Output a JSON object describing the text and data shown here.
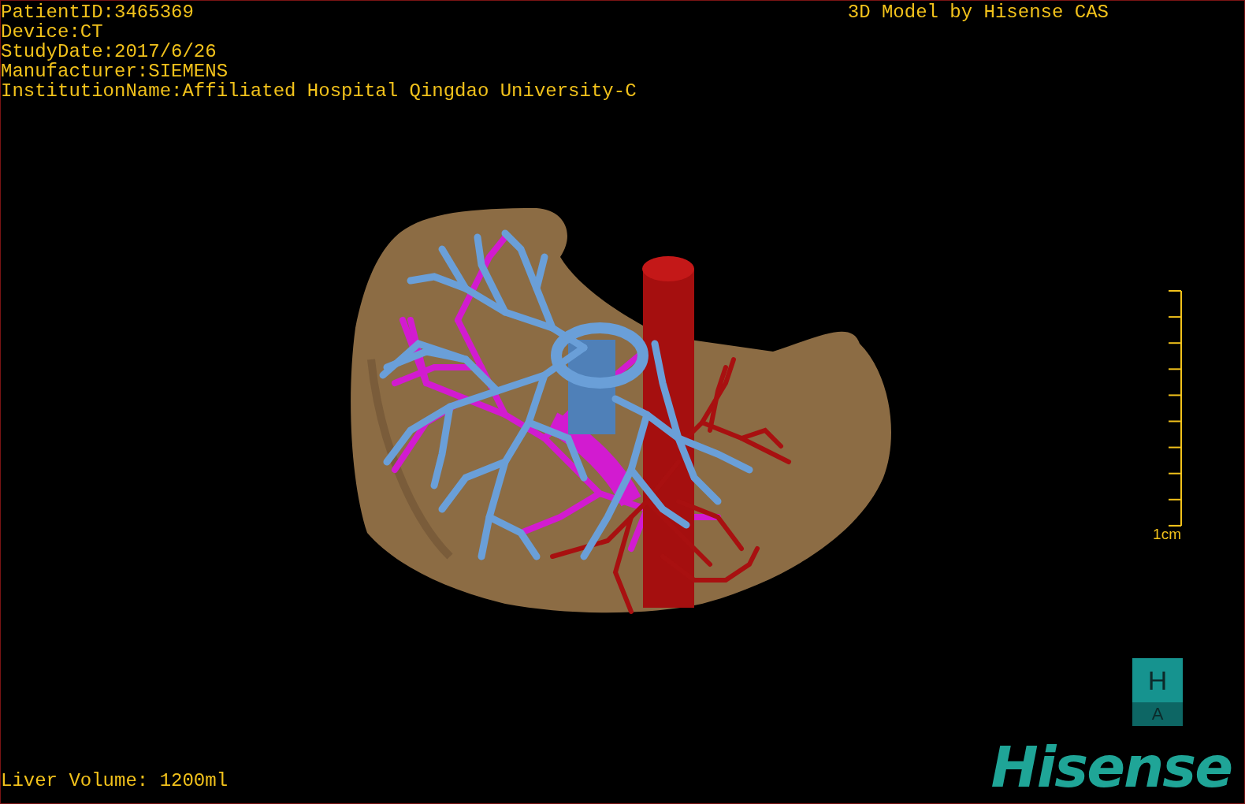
{
  "info": [
    "PatientID:3465369",
    "Device:CT",
    "StudyDate:2017/6/26",
    "Manufacturer:SIEMENS",
    "InstitutionName:Affiliated Hospital Qingdao University-C"
  ],
  "title": "3D Model by Hisense CAS",
  "scale_bar": {
    "label": "1cm"
  },
  "liver_volume": "Liver Volume: 1200ml",
  "orientation_cube": {
    "top": "H",
    "front": "A"
  },
  "logo": "Hisense"
}
